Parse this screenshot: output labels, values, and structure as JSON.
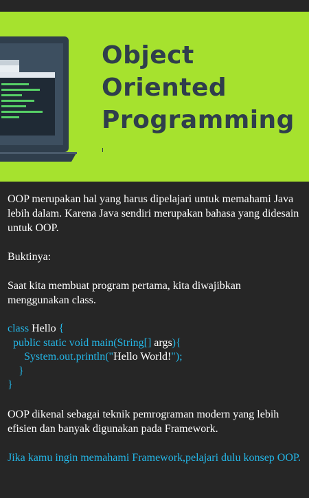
{
  "banner": {
    "title_lines": [
      "Object",
      "Oriented",
      "Programming"
    ],
    "colors": {
      "background": "#a6e22e",
      "title": "#2f3e4c",
      "laptop": "#2f3e4c",
      "screen": "#3a4a5a",
      "code_lines": "#57d167"
    }
  },
  "article": {
    "intro": "OOP merupakan hal yang harus dipelajari untuk memahami Java lebih dalam. Karena Java sendiri merupakan bahasa yang didesain untuk OOP.",
    "proof_label": "Buktinya:",
    "proof_text": "Saat kita membuat program pertama, kita diwajibkan menggunakan class.",
    "code": {
      "l1_kw": "class",
      "l1_name": " Hello ",
      "l1_brace": "{",
      "l2_kw": "  public static void main(String[]",
      "l2_arg": " args",
      "l2_brace": "){",
      "l3_kw": "      System.out.println(\"",
      "l3_str": "Hello World!",
      "l3_end": "\");",
      "l4": "    }",
      "l5": "}"
    },
    "outro": "OOP dikenal sebagai teknik pemrograman modern yang lebih efisien dan banyak digunakan pada Framework.",
    "cta": "Jika kamu ingin memahami Framework,pelajari dulu konsep OOP."
  },
  "colors": {
    "page_background": "#262626",
    "text": "#ffffff",
    "accent": "#24b6e6"
  }
}
